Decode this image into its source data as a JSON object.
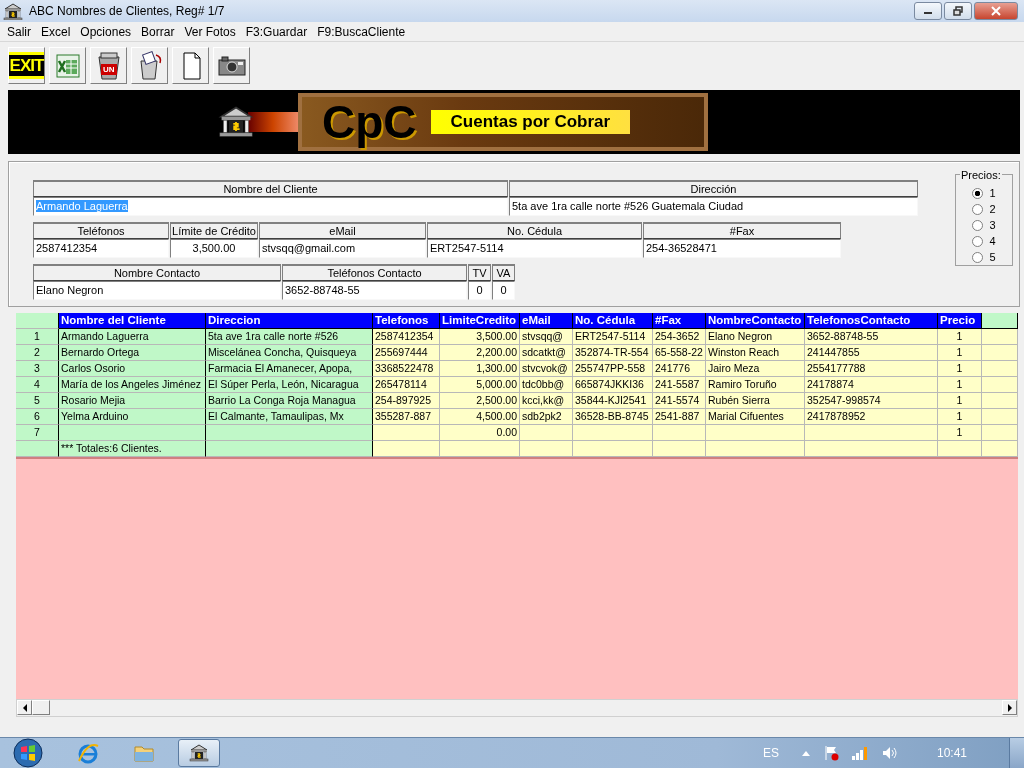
{
  "window": {
    "title": "ABC Nombres de Clientes, Reg# 1/7"
  },
  "menu": [
    "Salir",
    "Excel",
    "Opciones",
    "Borrar",
    "Ver Fotos",
    "F3:Guardar",
    "F9:BuscaCliente"
  ],
  "toolbar": [
    {
      "kind": "exit",
      "label": "EXIT"
    },
    {
      "kind": "excel"
    },
    {
      "kind": "trash",
      "label": "UN"
    },
    {
      "kind": "restore"
    },
    {
      "kind": "page"
    },
    {
      "kind": "camera"
    }
  ],
  "banner": {
    "logo": "CpC",
    "title": "Cuentas por Cobrar"
  },
  "form": {
    "client_fields": [
      {
        "label": "Nombre del Cliente",
        "value": "Armando Laguerra",
        "highlighted": true
      },
      {
        "label": "Dirección",
        "value": "5ta ave 1ra calle norte #526 Guatemala Ciudad",
        "highlighted": false
      }
    ],
    "detail_fields": [
      {
        "label": "Teléfonos",
        "value": "2587412354",
        "highlighted": false
      },
      {
        "label": "Límite de Crédito",
        "value": "3,500.00",
        "highlighted": false
      },
      {
        "label": "eMail",
        "value": "stvsqq@gmail.com",
        "highlighted": false
      },
      {
        "label": "No. Cédula",
        "value": "ERT2547-5114",
        "highlighted": false
      },
      {
        "label": "#Fax",
        "value": "254-36528471",
        "highlighted": false
      }
    ],
    "contact_fields": [
      {
        "label": "Nombre Contacto",
        "value": "Elano Negron",
        "highlighted": false
      },
      {
        "label": "Teléfonos Contacto",
        "value": "3652-88748-55",
        "highlighted": false
      },
      {
        "label": "TV",
        "value": "0",
        "highlighted": false
      },
      {
        "label": "VA",
        "value": "0",
        "highlighted": false
      }
    ],
    "prices": {
      "title": "Precios:",
      "options": [
        {
          "label": "1",
          "selected": true
        },
        {
          "label": "2",
          "selected": false
        },
        {
          "label": "3",
          "selected": false
        },
        {
          "label": "4",
          "selected": false
        },
        {
          "label": "5",
          "selected": false
        }
      ]
    }
  },
  "table": {
    "columns": [
      {
        "label": "Nombre del Cliente",
        "kind": "name"
      },
      {
        "label": "Direccion",
        "kind": "name"
      },
      {
        "label": "Telefonos",
        "kind": "text"
      },
      {
        "label": "LimiteCredito",
        "kind": "money"
      },
      {
        "label": "eMail",
        "kind": "text"
      },
      {
        "label": "No. Cédula",
        "kind": "text"
      },
      {
        "label": "#Fax",
        "kind": "text"
      },
      {
        "label": "NombreContacto",
        "kind": "text"
      },
      {
        "label": "TelefonosContacto",
        "kind": "text"
      },
      {
        "label": "Precio",
        "kind": "count"
      },
      {
        "kind": "blank"
      }
    ],
    "rows": [
      {
        "number": "1",
        "cells": [
          "Armando Laguerra",
          "5ta ave 1ra calle norte #526",
          "2587412354",
          "3,500.00",
          "stvsqq@",
          "ERT2547-5114",
          "254-3652",
          "Elano Negron",
          "3652-88748-55",
          "1",
          null
        ]
      },
      {
        "number": "2",
        "cells": [
          "Bernardo Ortega",
          "Miscelánea Concha, Quisqueya",
          "255697444",
          "2,200.00",
          "sdcatkt@",
          "352874-TR-554",
          "65-558-22",
          "Winston Reach",
          "241447855",
          "1",
          null
        ]
      },
      {
        "number": "3",
        "cells": [
          "Carlos Osorio",
          "Farmacia El Amanecer, Apopa,",
          "3368522478",
          "1,300.00",
          "stvcvok@",
          "255747PP-558",
          "241776",
          "Jairo Meza",
          "2554177788",
          "1",
          null
        ]
      },
      {
        "number": "4",
        "cells": [
          "María de los Angeles Jiménez",
          "El Súper Perla, León, Nicaragua",
          "265478114",
          "5,000.00",
          "tdc0bb@",
          "665874JKKI36",
          "241-5587",
          "Ramiro Toruño",
          "24178874",
          "1",
          null
        ]
      },
      {
        "number": "5",
        "cells": [
          "Rosario Mejia",
          "Barrio La Conga Roja Managua",
          "254-897925",
          "2,500.00",
          "kcci,kk@",
          "35844-KJI2541",
          "241-5574",
          "Rubén Sierra",
          "352547-998574",
          "1",
          null
        ]
      },
      {
        "number": "6",
        "cells": [
          "Yelma Arduino",
          "El Calmante, Tamaulipas, Mx",
          "355287-887",
          "4,500.00",
          "sdb2pk2",
          "36528-BB-8745",
          "2541-887",
          "Marial Cifuentes",
          "2417878952",
          "1",
          null
        ]
      },
      {
        "number": "7",
        "cells": [
          null,
          null,
          null,
          "0.00",
          null,
          null,
          null,
          null,
          null,
          "1",
          null
        ]
      },
      {
        "cells": [
          "*** Totales:6 Clientes.",
          null,
          null,
          null,
          null,
          null,
          null,
          null,
          null,
          null,
          null
        ]
      }
    ]
  },
  "taskbar": {
    "language": "ES",
    "clock": "10:41"
  }
}
